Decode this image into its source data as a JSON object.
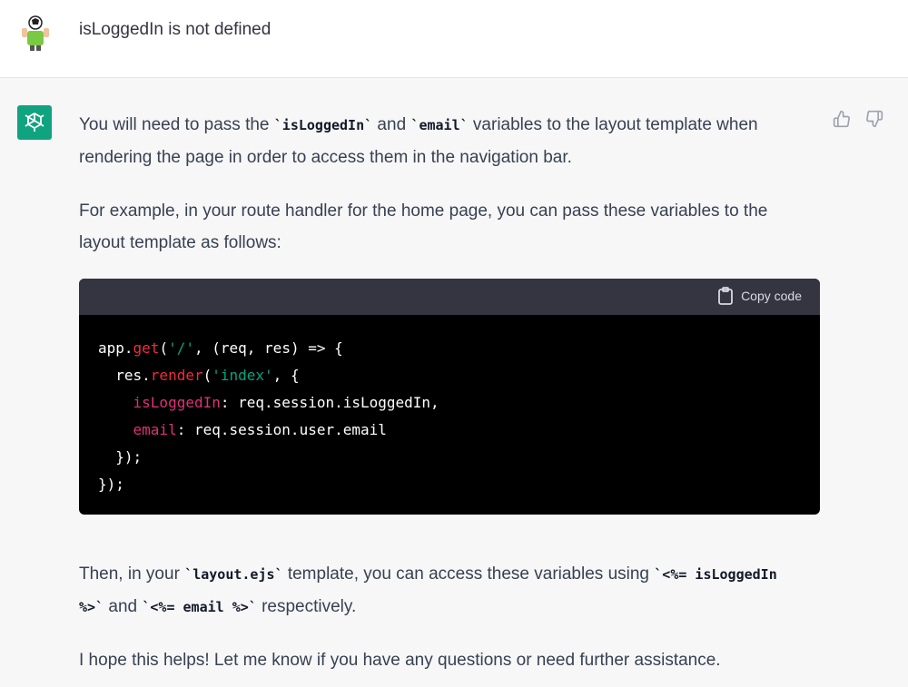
{
  "user_message": {
    "text": "isLoggedIn is not defined"
  },
  "assistant_message": {
    "p1": {
      "a": "You will need to pass the ",
      "code1": "`isLoggedIn`",
      "b": " and ",
      "code2": "`email`",
      "c": " variables to the layout template when rendering the page in order to access them in the navigation bar."
    },
    "p2": "For example, in your route handler for the home page, you can pass these variables to the layout template as follows:",
    "code_block": {
      "copy_label": "Copy code",
      "l1": {
        "a": "app.",
        "fn": "get",
        "b": "(",
        "str": "'/'",
        "c": ", (req, res) => {"
      },
      "l2": {
        "a": "  res.",
        "fn": "render",
        "b": "(",
        "str": "'index'",
        "c": ", {"
      },
      "l3": {
        "indent": "    ",
        "prop": "isLoggedIn",
        "rest": ": req.session.isLoggedIn,"
      },
      "l4": {
        "indent": "    ",
        "prop": "email",
        "rest": ": req.session.user.email"
      },
      "l5": "  });",
      "l6": "});"
    },
    "p3": {
      "a": "Then, in your ",
      "code1": "`layout.ejs`",
      "b": " template, you can access these variables using ",
      "code2": "`<%= isLoggedIn %>`",
      "c": " and ",
      "code3": "`<%= email %>`",
      "d": " respectively."
    },
    "p4": "I hope this helps! Let me know if you have any questions or need further assistance."
  },
  "colors": {
    "assistant_avatar": "#10a37f",
    "code_header": "#343541",
    "code_bg": "#000000",
    "function": "#f22c3d",
    "string": "#00a67d",
    "property": "#df3079"
  },
  "icons": [
    "user-avatar-icon",
    "openai-logo-icon",
    "thumbs-up-icon",
    "thumbs-down-icon",
    "clipboard-icon"
  ]
}
